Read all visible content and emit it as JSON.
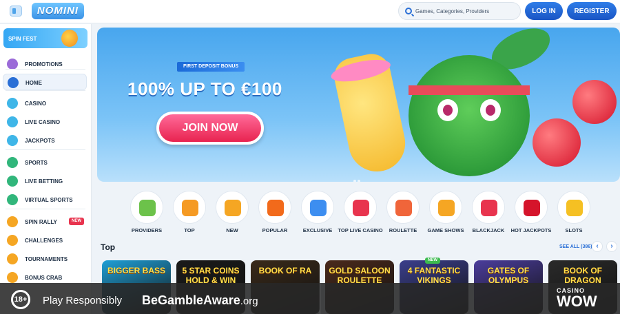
{
  "header": {
    "logo_text": "NOMINI",
    "search_placeholder": "Games, Categories, Providers",
    "login_label": "LOG IN",
    "register_label": "REGISTER"
  },
  "sidebar": {
    "spin_fest_label": "SPIN FEST",
    "items": [
      {
        "label": "PROMOTIONS",
        "icon": "gift-icon",
        "color": "#9b6bd8"
      },
      {
        "label": "HOME",
        "icon": "home-icon",
        "color": "#2a6fd6"
      },
      {
        "label": "CASINO",
        "icon": "casino-icon",
        "color": "#3fb6e8"
      },
      {
        "label": "LIVE CASINO",
        "icon": "live-casino-icon",
        "color": "#3fb6e8"
      },
      {
        "label": "JACKPOTS",
        "icon": "jackpots-icon",
        "color": "#3fb6e8"
      },
      {
        "label": "SPORTS",
        "icon": "sports-icon",
        "color": "#31b67b"
      },
      {
        "label": "LIVE BETTING",
        "icon": "live-betting-icon",
        "color": "#31b67b"
      },
      {
        "label": "VIRTUAL SPORTS",
        "icon": "virtual-sports-icon",
        "color": "#31b67b"
      },
      {
        "label": "SPIN RALLY",
        "icon": "spin-rally-icon",
        "color": "#f5a623",
        "badge": "NEW"
      },
      {
        "label": "CHALLENGES",
        "icon": "challenges-icon",
        "color": "#f5a623"
      },
      {
        "label": "TOURNAMENTS",
        "icon": "tournaments-icon",
        "color": "#f5a623"
      },
      {
        "label": "BONUS CRAB",
        "icon": "bonus-crab-icon",
        "color": "#f5a623"
      }
    ]
  },
  "banner": {
    "tag": "FIRST DEPOSIT BONUS",
    "headline": "100% UP TO €100",
    "cta": "JOIN NOW"
  },
  "categories": [
    {
      "label": "PROVIDERS",
      "icon": "providers-icon",
      "color": "#6cc24a"
    },
    {
      "label": "TOP",
      "icon": "crown-icon",
      "color": "#f59a23"
    },
    {
      "label": "NEW",
      "icon": "lightning-icon",
      "color": "#f5a623"
    },
    {
      "label": "POPULAR",
      "icon": "fire-icon",
      "color": "#f26a1b"
    },
    {
      "label": "EXCLUSIVE",
      "icon": "diamond-icon",
      "color": "#3d8ef0"
    },
    {
      "label": "TOP LIVE CASINO",
      "icon": "live-chip-icon",
      "color": "#e8344e"
    },
    {
      "label": "ROULETTE",
      "icon": "roulette-icon",
      "color": "#f0653a"
    },
    {
      "label": "GAME SHOWS",
      "icon": "orange-icon",
      "color": "#f5a623"
    },
    {
      "label": "BLACKJACK",
      "icon": "cards-icon",
      "color": "#e8344e"
    },
    {
      "label": "HOT JACKPOTS",
      "icon": "chili-icon",
      "color": "#d5142b"
    },
    {
      "label": "SLOTS",
      "icon": "slots-icon",
      "color": "#f5c023"
    }
  ],
  "top_section": {
    "title": "Top",
    "see_all": "SEE ALL (386)",
    "games": [
      {
        "title": "BIGGER BASS",
        "color": "#1f9fd6"
      },
      {
        "title": "5 STAR COINS HOLD & WIN",
        "color": "#1a1a1a"
      },
      {
        "title": "BOOK OF RA",
        "color": "#3a2a1a"
      },
      {
        "title": "GOLD SALOON ROULETTE",
        "color": "#4a2a1c"
      },
      {
        "title": "4 FANTASTIC VIKINGS",
        "color": "#3b3f8c",
        "badge": "NEW"
      },
      {
        "title": "GATES OF OLYMPUS",
        "color": "#4b3d9c"
      },
      {
        "title": "BOOK OF DRAGON",
        "color": "#2a2a2a"
      }
    ]
  },
  "responsible_bar": {
    "age": "18+",
    "play": "Play Responsibly",
    "begamble": "BeGambleAware",
    "begamble_suffix": ".org",
    "brand_top": "CASINO",
    "brand_bottom": "WOW"
  }
}
